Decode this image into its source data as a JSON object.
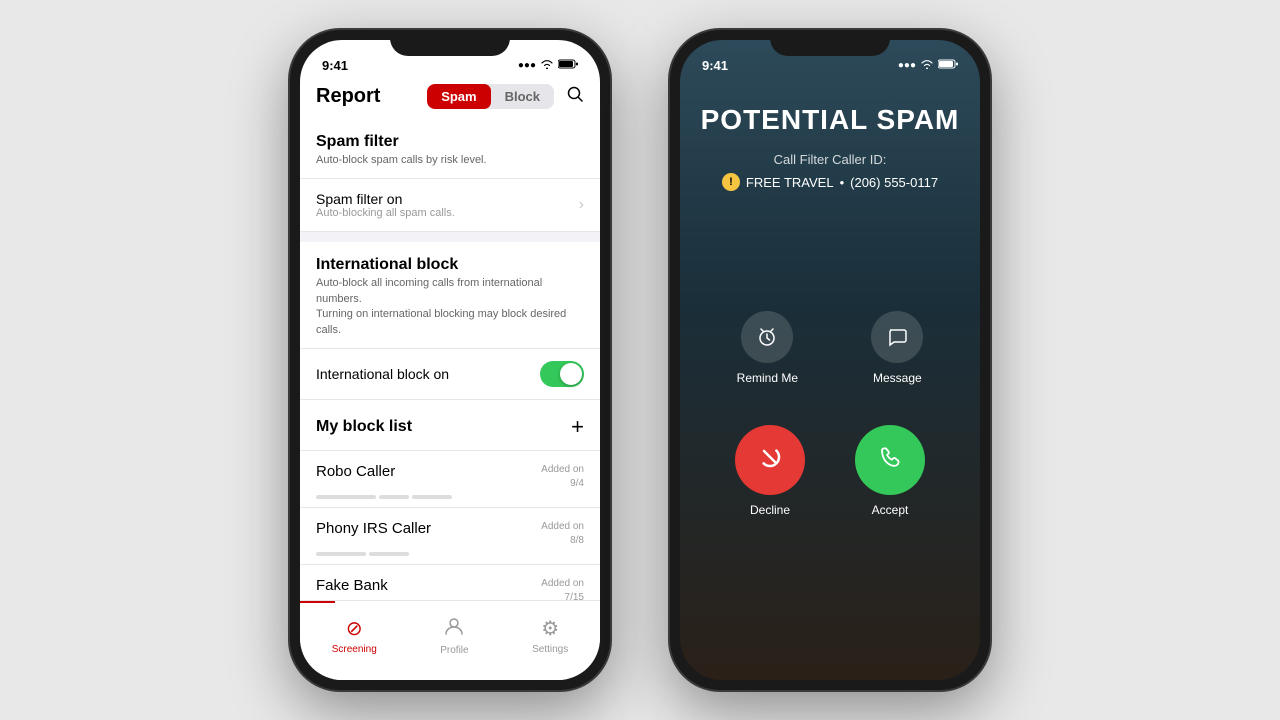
{
  "phone1": {
    "status": {
      "time": "9:41",
      "signal": "●●●●",
      "wifi": "WiFi",
      "battery": "Battery"
    },
    "header": {
      "title": "Report",
      "tab_spam": "Spam",
      "tab_block": "Block",
      "search_label": "Search"
    },
    "spam_filter": {
      "title": "Spam filter",
      "subtitle": "Auto-block spam calls by risk level.",
      "row_label": "Spam filter on",
      "row_sublabel": "Auto-blocking all spam calls."
    },
    "international_block": {
      "title": "International block",
      "subtitle": "Auto-block all incoming calls from international numbers.",
      "warning": "Turning on international blocking may block desired calls.",
      "row_label": "International block on"
    },
    "my_block_list": {
      "title": "My block list",
      "add_label": "+",
      "items": [
        {
          "name": "Robo Caller",
          "added_on": "Added on",
          "date": "9/4"
        },
        {
          "name": "Phony IRS Caller",
          "added_on": "Added on",
          "date": "8/8"
        },
        {
          "name": "Fake Bank",
          "added_on": "Added on",
          "date": "7/15"
        }
      ]
    },
    "bottom_nav": {
      "screening": "Screening",
      "profile": "Profile",
      "settings": "Settings"
    }
  },
  "phone2": {
    "status": {
      "time": "9:41"
    },
    "call": {
      "spam_label": "POTENTIAL SPAM",
      "caller_id_title": "Call Filter Caller ID:",
      "caller_name": "FREE TRAVEL",
      "caller_number": "(206) 555-0117",
      "remind_me": "Remind Me",
      "message": "Message",
      "decline": "Decline",
      "accept": "Accept"
    }
  }
}
